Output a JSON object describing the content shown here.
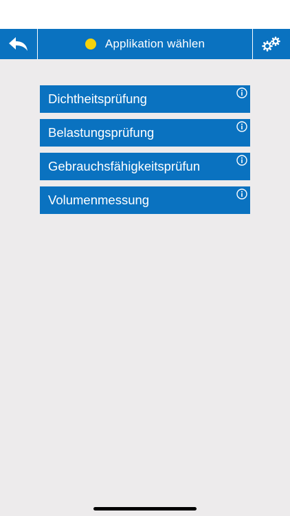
{
  "header": {
    "title": "Applikation wählen",
    "status_dot_color": "#f5d20b",
    "back_icon": "back-arrow-icon",
    "settings_icon": "gears-icon"
  },
  "applications": [
    {
      "label": "Dichtheitsprüfung",
      "info_icon": "info-icon"
    },
    {
      "label": "Belastungsprüfung",
      "info_icon": "info-icon"
    },
    {
      "label": "Gebrauchsfähigkeitsprüfun",
      "info_icon": "info-icon"
    },
    {
      "label": "Volumenmessung",
      "info_icon": "info-icon"
    }
  ],
  "colors": {
    "primary": "#0a72c0",
    "background": "#edebec"
  }
}
